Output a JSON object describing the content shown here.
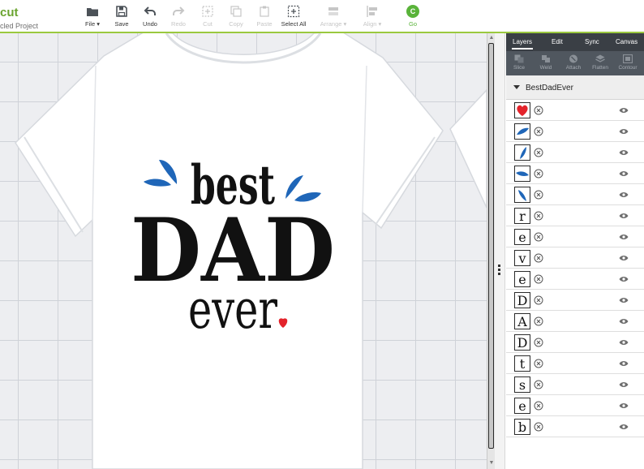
{
  "app": {
    "brand": "cut",
    "project_title": "cled Project"
  },
  "toolbar": {
    "tools": [
      {
        "key": "file",
        "label": "File ▾",
        "icon": "folder-icon",
        "enabled": true
      },
      {
        "key": "save",
        "label": "Save",
        "icon": "floppy-disk-icon",
        "enabled": true
      },
      {
        "key": "undo",
        "label": "Undo",
        "icon": "undo-arrow-icon",
        "enabled": true
      },
      {
        "key": "redo",
        "label": "Redo",
        "icon": "redo-arrow-icon",
        "enabled": false
      },
      {
        "key": "cut",
        "label": "Cut",
        "icon": "cut-icon",
        "enabled": false
      },
      {
        "key": "copy",
        "label": "Copy",
        "icon": "copy-icon",
        "enabled": false
      },
      {
        "key": "paste",
        "label": "Paste",
        "icon": "paste-icon",
        "enabled": false
      },
      {
        "key": "select_all",
        "label": "Select All",
        "icon": "select-all-icon",
        "enabled": true
      },
      {
        "key": "arrange",
        "label": "Arrange ▾",
        "icon": "arrange-icon",
        "enabled": false
      },
      {
        "key": "align",
        "label": "Align ▾",
        "icon": "align-icon",
        "enabled": false
      }
    ],
    "go": {
      "label": "Go",
      "badge": "C",
      "color": "#59b33a"
    }
  },
  "canvas": {
    "design": {
      "line1": "best",
      "line2": "DAD",
      "line3": "ever",
      "text_color": "#111111",
      "splash_color": "#1f66b8",
      "heart_color": "#e3232b"
    }
  },
  "panel": {
    "tabs": [
      "Layers",
      "Edit",
      "Sync",
      "Canvas"
    ],
    "active_tab": "Layers",
    "actions": [
      "Slice",
      "Weld",
      "Attach",
      "Flatten",
      "Contour"
    ],
    "group_name": "BestDadEver",
    "layers": [
      {
        "kind": "heart"
      },
      {
        "kind": "splash"
      },
      {
        "kind": "splash"
      },
      {
        "kind": "splash"
      },
      {
        "kind": "splash"
      },
      {
        "kind": "letter",
        "char": "r"
      },
      {
        "kind": "letter",
        "char": "e"
      },
      {
        "kind": "letter",
        "char": "v"
      },
      {
        "kind": "letter",
        "char": "e"
      },
      {
        "kind": "letter",
        "char": "D"
      },
      {
        "kind": "letter",
        "char": "A"
      },
      {
        "kind": "letter",
        "char": "D"
      },
      {
        "kind": "letter",
        "char": "t"
      },
      {
        "kind": "letter",
        "char": "s"
      },
      {
        "kind": "letter",
        "char": "e"
      },
      {
        "kind": "letter",
        "char": "b"
      }
    ]
  }
}
